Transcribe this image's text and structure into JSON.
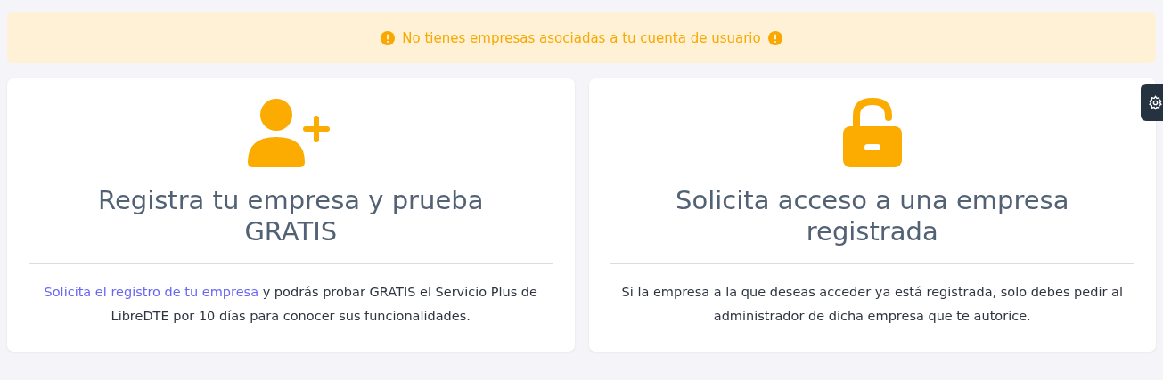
{
  "alert": {
    "text": "No tienes empresas asociadas a tu cuenta de usuario"
  },
  "cards": [
    {
      "kind": "register",
      "title": "Registra tu empresa y prueba GRATIS",
      "link": "Solicita el registro de tu empresa",
      "text": " y podrás probar GRATIS el Servicio Plus de LibreDTE por 10 días para conocer sus funcionalidades."
    },
    {
      "kind": "access",
      "title": "Solicita acceso a una empresa registrada",
      "text": "Si la empresa a la que deseas acceder ya está registrada, solo debes pedir al administrador de dicha empresa que te autorice."
    }
  ]
}
